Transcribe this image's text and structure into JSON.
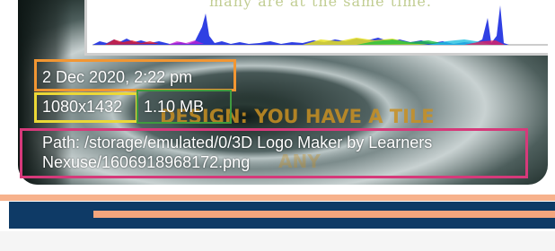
{
  "file_info": {
    "date": "2 Dec 2020, 2:22 pm",
    "resolution": "1080x1432",
    "size": "1.10 MB",
    "path": "Path:  /storage/emulated/0/3D Logo Maker by Learners Nexuse/1606918968172.png"
  },
  "background_art": {
    "caption": "many are at the same time.",
    "headline": "DESIGN: YOU HAVE A TILE",
    "faded_text": "ANY"
  },
  "colors": {
    "date_box": "#f29632",
    "resolution_box": "#ecd836",
    "size_box": "#3f9b3f",
    "path_box": "#d6397a",
    "navy_bar": "#0e3a66",
    "orange_line": "#f3a57d"
  }
}
